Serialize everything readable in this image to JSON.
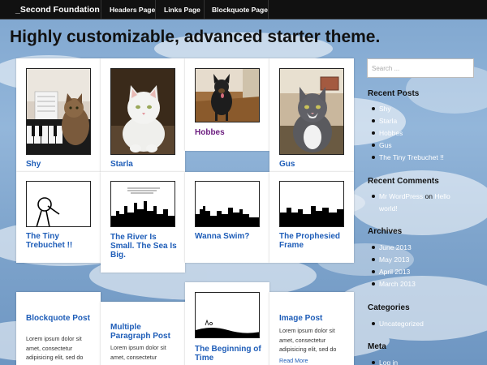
{
  "header": {
    "brand": "_Second Foundation",
    "nav": [
      "Headers Page",
      "Links Page",
      "Blockquote Page"
    ]
  },
  "tagline": "Highly customizable, advanced starter theme.",
  "tiles": [
    {
      "title": "Shy",
      "image": "cat-at-piano-photo"
    },
    {
      "title": "Starla",
      "image": "white-cat-photo"
    },
    {
      "title": "Hobbes",
      "image": "dog-photo"
    },
    {
      "title": "Gus",
      "image": "gray-cat-photo"
    },
    {
      "title": "The Tiny Trebuchet !!",
      "image": "stick-figure-comic"
    },
    {
      "title": "The River Is Small. The Sea Is Big.",
      "image": "skyline-comic"
    },
    {
      "title": "Wanna Swim?",
      "image": "skyline-comic"
    },
    {
      "title": "The Prophesied Frame",
      "image": "skyline-comic"
    },
    {
      "title": "Blockquote Post",
      "excerpt": "Lorem ipsum dolor sit amet, consectetur adipisicing elit, sed do"
    },
    {
      "title": "Multiple Paragraph Post",
      "excerpt": "Lorem ipsum dolor sit amet, consectetur"
    },
    {
      "title": "The Beginning of Time",
      "image": "hill-comic"
    },
    {
      "title": "Image Post",
      "excerpt": "Lorem ipsum dolor sit amet, consectetur adipisicing elit, sed do",
      "read_more": "Read More"
    }
  ],
  "sidebar": {
    "search_placeholder": "Search ...",
    "recent_posts": {
      "title": "Recent Posts",
      "items": [
        "Shy",
        "Starla",
        "Hobbes",
        "Gus",
        "The Tiny Trebuchet !!"
      ]
    },
    "recent_comments": {
      "title": "Recent Comments",
      "author": "Mr WordPress",
      "on": "on",
      "post_line1": "Hello",
      "post_line2": "world!"
    },
    "archives": {
      "title": "Archives",
      "items": [
        "June 2013",
        "May 2013",
        "April 2013",
        "March 2013"
      ]
    },
    "categories": {
      "title": "Categories",
      "items": [
        "Uncategorized"
      ]
    },
    "meta": {
      "title": "Meta",
      "items": [
        "Log in"
      ]
    }
  },
  "colors": {
    "link": "#1e5db8",
    "visited": "#6a1b7e",
    "topbar": "#111111"
  }
}
